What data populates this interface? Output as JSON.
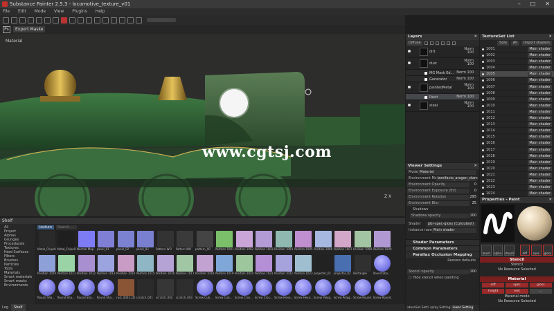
{
  "window": {
    "title": "Substance Painter 2.5.3 - locomotive_texture_v01",
    "buttons": [
      "–",
      "□",
      "✕"
    ]
  },
  "menu": [
    "File",
    "Edit",
    "Mode",
    "View",
    "Plugins",
    "Help"
  ],
  "subtoolbar": {
    "ps_label": "Ps",
    "export_label": "Export Maske"
  },
  "viewport": {
    "label": "Material",
    "watermark": "www.cgtsj.com",
    "axis_label": "Z",
    "axis_label2": "X"
  },
  "layers": {
    "title": "Layers",
    "channel": "Diffuse",
    "rows": [
      {
        "name": "dirt",
        "blend": "Norm",
        "opacity": "100",
        "sub": false,
        "sel": false
      },
      {
        "name": "dust",
        "blend": "Norm",
        "opacity": "100",
        "sub": false,
        "sel": false
      },
      {
        "name": "MG Mask Ed...",
        "blend": "Norm",
        "opacity": "100",
        "sub": true,
        "sel": false
      },
      {
        "name": "Generator",
        "blend": "Norm",
        "opacity": "100",
        "sub": true,
        "sel": false
      },
      {
        "name": "paintedMetal",
        "blend": "Norm",
        "opacity": "100",
        "sub": false,
        "sel": false
      },
      {
        "name": "Paint",
        "blend": "Norm",
        "opacity": "100",
        "sub": true,
        "sel": true
      },
      {
        "name": "steel",
        "blend": "Norm",
        "opacity": "100",
        "sub": false,
        "sel": false
      }
    ]
  },
  "texture_set_list": {
    "title": "TextureSet List",
    "solo_label": "Solo",
    "all_label": "All",
    "import_label": "Import shaders",
    "shader_label": "Main shader",
    "items": [
      "1001",
      "1002",
      "1003",
      "1004",
      "1005",
      "1006",
      "1007",
      "1008",
      "1009",
      "1010",
      "1011",
      "1012",
      "1013",
      "1014",
      "1015",
      "1016",
      "1017",
      "1018",
      "1019",
      "1020",
      "1021",
      "1022",
      "1023",
      "1024"
    ],
    "selected_index": 4
  },
  "viewer_settings": {
    "title": "Viewer Settings",
    "mode_label": "Mode",
    "mode_value": "Material",
    "env_map_label": "Environment Map",
    "env_map_value": "bonifacio_aragon_stars",
    "sliders": [
      {
        "label": "Environment Opacity",
        "value": "0"
      },
      {
        "label": "Environment Exposure (EV)",
        "value": "0"
      },
      {
        "label": "Environment Rotation",
        "value": "295"
      },
      {
        "label": "Environment Blur",
        "value": "25"
      }
    ],
    "shadows_label": "Shadows",
    "shadows_opacity_label": "Shadows opacity",
    "shadows_opacity_value": "100",
    "shader_label": "Shader",
    "shader_value": "pbr-spec-gloss (Cutoutest)",
    "instance_label": "Instance name",
    "instance_value": "Main shader",
    "sections": [
      "Shader Parameters",
      "Common Parameters",
      "Parallax Occlusion Mapping"
    ],
    "restore_label": "Restore defaults",
    "stencil_label": "Stencil opacity",
    "stencil_value": "100",
    "hide_stencil_label": "Hide stencil when painting",
    "tabs": [
      "xtureSet Setti",
      "splay Setting",
      "iewer Setting"
    ],
    "active_tab": 2
  },
  "properties": {
    "title": "Properties - Paint",
    "brush_chips": [
      "brush",
      "alpha",
      "stencil"
    ],
    "material_chips": [
      "diff",
      "spec",
      "gloss"
    ],
    "stencil_section": "Stencil",
    "stencil_label": "Stencil",
    "stencil_none": "No Resource Selected",
    "material_section": "Material",
    "row1": [
      "diff",
      "spec",
      "gloss"
    ],
    "row2": [
      "height",
      "emi",
      "..."
    ],
    "material_mode_label": "Material mode",
    "material_mode_value": "No Resource Selected"
  },
  "shelf": {
    "title": "Shelf",
    "categories": [
      "All",
      "Project",
      "Alphas",
      "Grunges",
      "Procedurals",
      "Textures",
      "Hard Surfaces",
      "Filters",
      "Brushes",
      "Particles",
      "Tools",
      "Materials",
      "Smart materials",
      "Smart masks",
      "Environments"
    ],
    "filter_chip": "texture",
    "search_placeholder": "Search...",
    "items": [
      {
        "label": "Metal_Chips01",
        "color": "#2a2a2a"
      },
      {
        "label": "Metal_Chips01",
        "color": "#1f1f1f"
      },
      {
        "label": "Normal Map",
        "color": "#7e7cf4"
      },
      {
        "label": "panel_01",
        "color": "#7f7fd6"
      },
      {
        "label": "panel_02",
        "color": "#7b82d2"
      },
      {
        "label": "panel_03",
        "color": "#7a80d0"
      },
      {
        "label": "Pattern WO",
        "color": "#333"
      },
      {
        "label": "Pattern WO",
        "color": "#3a3a3a"
      },
      {
        "label": "pattern_00",
        "color": "#444"
      },
      {
        "label": "Position 1001",
        "color": "#7bbf6a"
      },
      {
        "label": "Position 1002",
        "color": "#c9a5d8"
      },
      {
        "label": "Position 1003",
        "color": "#b39bd6"
      },
      {
        "label": "Position 1004",
        "color": "#8fb9b0"
      },
      {
        "label": "Position 1005",
        "color": "#c08fd0"
      },
      {
        "label": "Position 1006",
        "color": "#a6b7e0"
      },
      {
        "label": "Position 1007",
        "color": "#d2a7c9"
      },
      {
        "label": "Position 1008",
        "color": "#a3c4a2"
      },
      {
        "label": "Position 1009",
        "color": "#b098d2"
      },
      {
        "label": "Position 1010",
        "color": "#8da0d8"
      },
      {
        "label": "Position 1011",
        "color": "#9ad4a6"
      },
      {
        "label": "Position 1012",
        "color": "#a88fd0"
      },
      {
        "label": "Position 1013",
        "color": "#9ca4e0"
      },
      {
        "label": "Position 1014",
        "color": "#c89cc4"
      },
      {
        "label": "Position 1015",
        "color": "#8fb6c4"
      },
      {
        "label": "Position 1016",
        "color": "#b6a3d6"
      },
      {
        "label": "Position 1017",
        "color": "#a0c6a4"
      },
      {
        "label": "Position 1018",
        "color": "#c2a2d0"
      },
      {
        "label": "Position 1019",
        "color": "#7fa7d8"
      },
      {
        "label": "Position 1020",
        "color": "#9ec69c"
      },
      {
        "label": "Position 1021",
        "color": "#b48fd6"
      },
      {
        "label": "Position 1022",
        "color": "#a6a2dc"
      },
      {
        "label": "Position 1023",
        "color": "#9fbfd0"
      },
      {
        "label": "projector_01",
        "color": "#222"
      },
      {
        "label": "projector_02",
        "color": "#4a6fb0"
      },
      {
        "label": "Rectangle",
        "color": "#303030"
      },
      {
        "label": "Round Sha...",
        "color": "#7a7ae8"
      },
      {
        "label": "Round Sha...",
        "color": "#7c7ae2"
      },
      {
        "label": "Round Sha...",
        "color": "#8080e6"
      },
      {
        "label": "Round Sha...",
        "color": "#7878e0"
      },
      {
        "label": "Round Sha...",
        "color": "#7d7be4"
      },
      {
        "label": "rust_0001_DIF",
        "color": "#8a5535"
      },
      {
        "label": "scratch_001",
        "color": "#2b2b2b"
      },
      {
        "label": "scratch_002",
        "color": "#363636"
      },
      {
        "label": "scratch_003",
        "color": "#2e2e2e"
      },
      {
        "label": "Screw Cub...",
        "color": "#7b79e4"
      },
      {
        "label": "Screw Cub...",
        "color": "#7f7de6"
      },
      {
        "label": "Screw Cros...",
        "color": "#7878e0"
      },
      {
        "label": "Screw Cros...",
        "color": "#7c7ae2"
      },
      {
        "label": "Screw Hexa...",
        "color": "#7a7ae4"
      },
      {
        "label": "Screw Hexa...",
        "color": "#807ee6"
      },
      {
        "label": "Screw Polyg...",
        "color": "#7677de"
      },
      {
        "label": "Screw Polyg...",
        "color": "#7b79e2"
      },
      {
        "label": "Screw Round...",
        "color": "#7a7ae0"
      },
      {
        "label": "Screw Round...",
        "color": "#7d7be4"
      }
    ],
    "tabs": [
      "Log",
      "Shelf"
    ]
  }
}
